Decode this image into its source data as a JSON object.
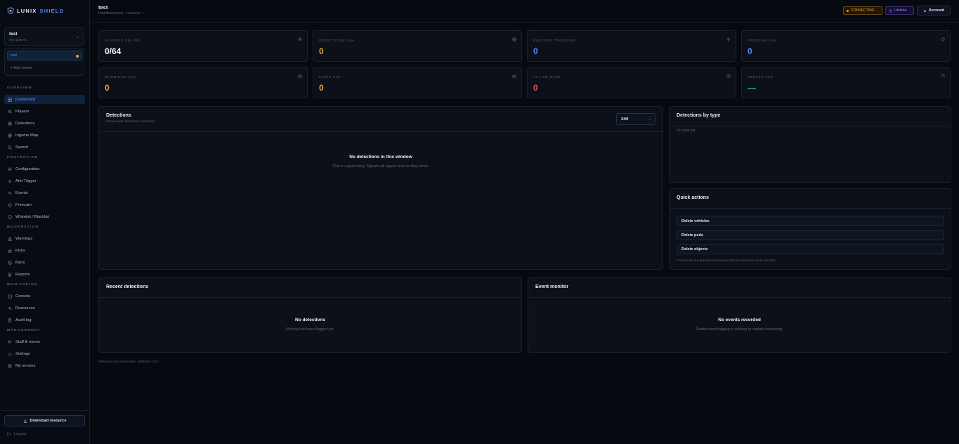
{
  "brand": {
    "name_part1": "LUNIX",
    "name_part2": "SHIELD"
  },
  "server_select": {
    "name": "test",
    "sub": "0/64 players"
  },
  "server_list": {
    "items": [
      {
        "label": "test"
      }
    ],
    "add_label": "+ Add server"
  },
  "nav": {
    "sections": [
      {
        "title": "OVERVIEW",
        "items": [
          "Dashboard",
          "Players",
          "Detections",
          "Ingame Map",
          "Search"
        ]
      },
      {
        "title": "PROTECTION",
        "items": [
          "Configuration",
          "Anti Trigger",
          "Events",
          "Freecam",
          "Whitelist / Blacklist"
        ]
      },
      {
        "title": "MODERATION",
        "items": [
          "Warnings",
          "Kicks",
          "Bans",
          "Reports"
        ]
      },
      {
        "title": "MONITORING",
        "items": [
          "Console",
          "Resources",
          "Audit log"
        ]
      },
      {
        "title": "MANAGEMENT",
        "items": [
          "Staff & rooms",
          "Settings",
          "My servers"
        ]
      }
    ],
    "active": "Dashboard"
  },
  "sidebar_footer": {
    "download_label": "Download resource",
    "logout_label": "Logout"
  },
  "header": {
    "title": "test",
    "subtitle": "Heartbeat never · resource —",
    "status_badge": "CONNECTING",
    "plan_badge": "Lifetime",
    "account_label": "Account"
  },
  "stats": [
    {
      "label": "PLAYERS ONLINE",
      "value": "0/64",
      "color": "#f1f4f9",
      "icon": "users-icon"
    },
    {
      "label": "DETECTIONS 24H",
      "value": "0",
      "color": "#e0a63a",
      "icon": "target-icon"
    },
    {
      "label": "BLOCKED TRIGGERS",
      "value": "0",
      "color": "#4d8dff",
      "icon": "bolt-icon"
    },
    {
      "label": "FREECAM 24H",
      "value": "0",
      "color": "#4d8dff",
      "icon": "crosshair-icon"
    },
    {
      "label": "WARNINGS 24H",
      "value": "0",
      "color": "#e0a63a",
      "icon": "crown-icon"
    },
    {
      "label": "KICKS 24H",
      "value": "0",
      "color": "#e0a63a",
      "icon": "crown-icon"
    },
    {
      "label": "ACTIVE BANS",
      "value": "0",
      "color": "#ef4d5a",
      "icon": "ban-icon"
    },
    {
      "label": "SERVER FPS",
      "value": "—",
      "color": "#2fc98a",
      "icon": "gauge-icon"
    }
  ],
  "detections_panel": {
    "title": "Detections",
    "subtitle": "Server-side detections over time",
    "range_value": "24H",
    "empty_title": "No detections in this window",
    "empty_sub": "That is a good thing. Signals will appear here as they arrive."
  },
  "by_type_panel": {
    "title": "Detections by type",
    "empty": "No data yet."
  },
  "quick_actions": {
    "title": "Quick actions",
    "buttons": [
      "Delete vehicles",
      "Delete peds",
      "Delete objects"
    ],
    "note": "Commands are queued and executed by the resource on its next poll."
  },
  "recent_panel": {
    "title": "Recent detections",
    "empty_title": "No detections",
    "empty_sub": "Nothing has been flagged yet."
  },
  "event_panel": {
    "title": "Event monitor",
    "empty_title": "No events recorded",
    "empty_sub": "Enable event logging in settings to capture everything."
  },
  "footer_note": "Resource not connected · platform 1.0.0",
  "colors": {
    "accent": "#4d8dff",
    "warning": "#e0a63a",
    "danger": "#ef4d5a",
    "success": "#2fc98a",
    "plan": "#9b86ff"
  }
}
